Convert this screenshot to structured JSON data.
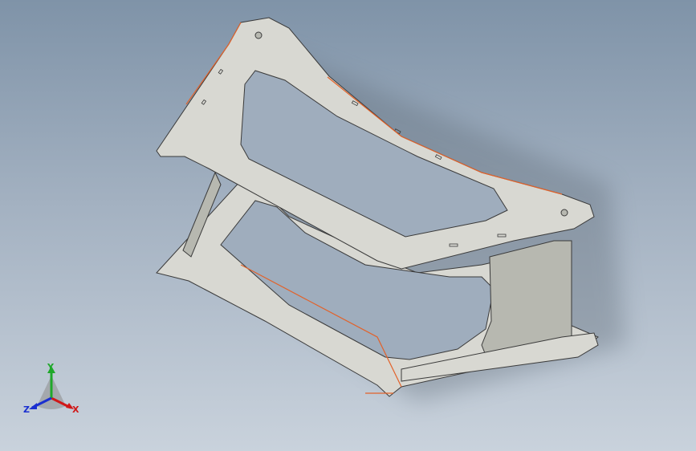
{
  "viewport": {
    "background_top": "#7f93a8",
    "background_bottom": "#c9d2dc"
  },
  "model": {
    "part_color": "#d8d8d2",
    "shadow_color": "#b7b8b0",
    "cross_brace_color": "#c3c4ad",
    "edge_color": "#3a3a3a",
    "highlight_edge_color": "#e2622a"
  },
  "triad": {
    "x_label": "X",
    "y_label": "Y",
    "z_label": "Z",
    "x_color": "#d01818",
    "y_color": "#1fa82a",
    "z_color": "#1a2fd0"
  }
}
